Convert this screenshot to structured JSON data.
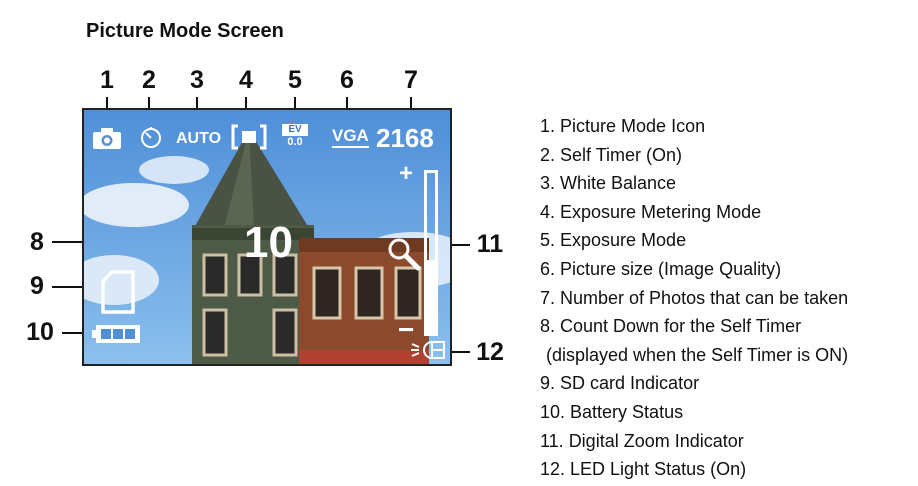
{
  "title": "Picture Mode Screen",
  "top_callouts": [
    "1",
    "2",
    "3",
    "4",
    "5",
    "6",
    "7"
  ],
  "side_callouts": {
    "c8": "8",
    "c9": "9",
    "c10": "10",
    "c11": "11",
    "c12": "12"
  },
  "hud": {
    "white_balance": "AUTO",
    "ev_label": "EV",
    "ev_value": "0.0",
    "picture_size": "VGA",
    "photos_remaining": "2168",
    "countdown": "10",
    "zoom_plus": "+",
    "zoom_minus": "−"
  },
  "legend": [
    "1. Picture Mode Icon",
    "2. Self Timer (On)",
    "3. White Balance",
    "4. Exposure Metering Mode",
    "5. Exposure Mode",
    "6. Picture size (Image Quality)",
    "7. Number of Photos that can be taken",
    "8. Count Down for the Self Timer",
    "(displayed when the Self Timer is ON)",
    "9. SD card Indicator",
    "10. Battery Status",
    "11. Digital Zoom Indicator",
    "12. LED Light Status (On)"
  ],
  "icons": [
    "camera-icon",
    "self-timer-icon",
    "metering-icon",
    "sd-card-icon",
    "battery-icon",
    "magnifier-icon",
    "led-light-icon"
  ]
}
